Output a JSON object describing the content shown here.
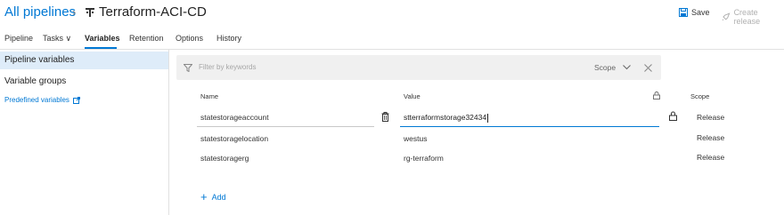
{
  "header": {
    "breadcrumb_root": "All pipelines",
    "breadcrumb_sep": "›",
    "pipeline_title": "Terraform-ACI-CD",
    "save_label": "Save",
    "create_release_label": "Create release"
  },
  "tabs": [
    {
      "label": "Pipeline"
    },
    {
      "label": "Tasks ∨"
    },
    {
      "label": "Variables"
    },
    {
      "label": "Retention"
    },
    {
      "label": "Options"
    },
    {
      "label": "History"
    }
  ],
  "sidebar": {
    "items": [
      {
        "label": "Pipeline variables"
      },
      {
        "label": "Variable groups"
      }
    ],
    "link_label": "Predefined variables"
  },
  "filter": {
    "placeholder": "Filter by keywords",
    "scope_label": "Scope"
  },
  "table": {
    "headers": {
      "name": "Name",
      "value": "Value",
      "scope": "Scope"
    },
    "rows": [
      {
        "name": "statestorageaccount",
        "value": "stterraformstorage32434",
        "scope": "Release"
      },
      {
        "name": "statestoragelocation",
        "value": "westus",
        "scope": "Release"
      },
      {
        "name": "statestoragerg",
        "value": "rg-terraform",
        "scope": "Release"
      }
    ]
  },
  "add_label": "Add",
  "colors": {
    "accent": "#0078d4",
    "selected_bg": "#deecf9",
    "filter_bg": "#f0f0f0"
  },
  "icons": [
    "pipeline-icon",
    "save-icon",
    "rocket-icon",
    "filter-icon",
    "chevron-down-icon",
    "close-icon",
    "lock-icon",
    "trash-icon",
    "external-link-icon",
    "plus-icon"
  ]
}
